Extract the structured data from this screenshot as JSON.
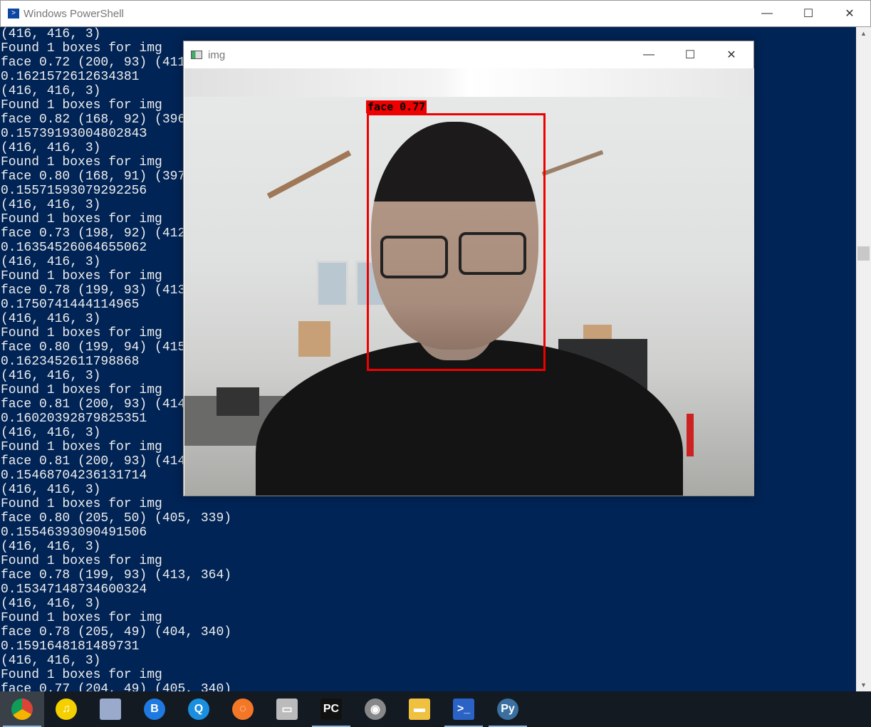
{
  "powershell": {
    "title": "Windows PowerShell",
    "icon": "powershell-icon"
  },
  "console_lines": [
    "(416, 416, 3)",
    "Found 1 boxes for img",
    "face 0.72 (200, 93) (411,",
    "0.1621572612634381",
    "(416, 416, 3)",
    "Found 1 boxes for img",
    "face 0.82 (168, 92) (396,",
    "0.1573919300480284З",
    "(416, 416, 3)",
    "Found 1 boxes for img",
    "face 0.80 (168, 91) (397,",
    "0.15571593079292256",
    "(416, 416, 3)",
    "Found 1 boxes for img",
    "face 0.73 (198, 92) (412,",
    "0.16354526064655062",
    "(416, 416, 3)",
    "Found 1 boxes for img",
    "face 0.78 (199, 93) (413,",
    "0.1750741444114965",
    "(416, 416, 3)",
    "Found 1 boxes for img",
    "face 0.80 (199, 94) (415,",
    "0.1623452611798868",
    "(416, 416, 3)",
    "Found 1 boxes for img",
    "face 0.81 (200, 93) (414,",
    "0.16020392879825351",
    "(416, 416, 3)",
    "Found 1 boxes for img",
    "face 0.81 (200, 93) (414,",
    "0.15468704236131714",
    "(416, 416, 3)",
    "Found 1 boxes for img",
    "face 0.80 (205, 50) (405, 339)",
    "0.15546393090491506",
    "(416, 416, 3)",
    "Found 1 boxes for img",
    "face 0.78 (199, 93) (413, 364)",
    "0.15347148734600324",
    "(416, 416, 3)",
    "Found 1 boxes for img",
    "face 0.78 (205, 49) (404, 340)",
    "0.1591648181489731",
    "(416, 416, 3)",
    "Found 1 boxes for img",
    "face 0.77 (204, 49) (405, 340)"
  ],
  "img_window": {
    "title": "img",
    "detection_label": "face 0.77"
  },
  "window_controls": {
    "minimize": "—",
    "maximize": "☐",
    "close": "✕"
  },
  "taskbar": [
    {
      "name": "chrome",
      "glyph": "",
      "color": "#db4437"
    },
    {
      "name": "qq-music",
      "glyph": "♫",
      "color": "#f5d000"
    },
    {
      "name": "notepad",
      "glyph": "",
      "color": "#9ac"
    },
    {
      "name": "baidu-netdisk",
      "glyph": "B",
      "color": "#1e7ae0"
    },
    {
      "name": "qq-browser",
      "glyph": "Q",
      "color": "#1a8fe0"
    },
    {
      "name": "jupyter",
      "glyph": "◌",
      "color": "#f37726"
    },
    {
      "name": "monitor",
      "glyph": "▭",
      "color": "#bbb"
    },
    {
      "name": "pycharm",
      "glyph": "PC",
      "color": "#111"
    },
    {
      "name": "eagle-app",
      "glyph": "◉",
      "color": "#888"
    },
    {
      "name": "file-explorer",
      "glyph": "▬",
      "color": "#f0c040"
    },
    {
      "name": "powershell",
      "glyph": ">_",
      "color": "#2a62c6"
    },
    {
      "name": "python",
      "glyph": "Py",
      "color": "#3b6fa0"
    }
  ]
}
